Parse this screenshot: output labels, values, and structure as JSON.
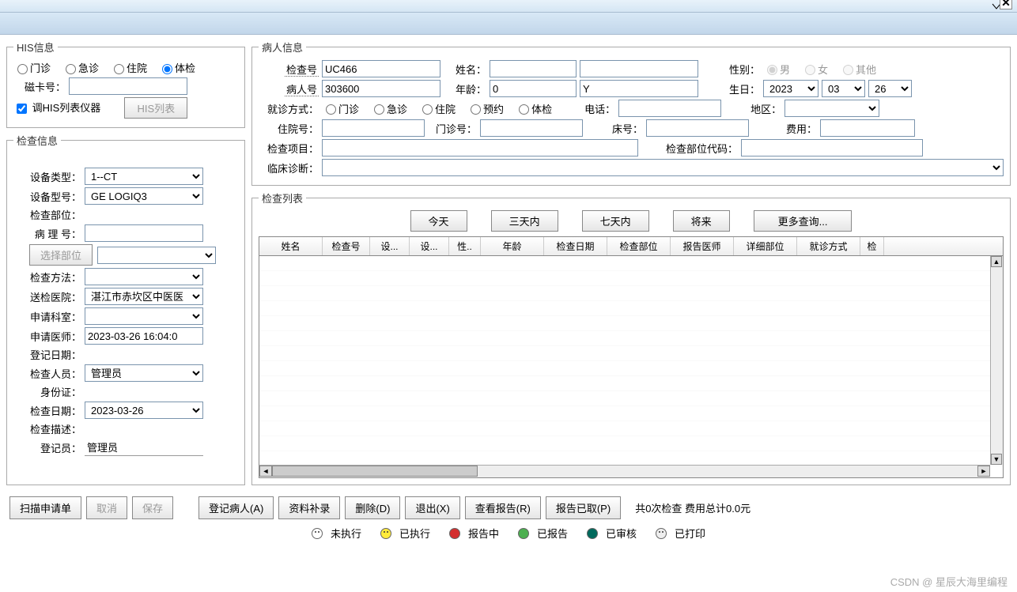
{
  "his": {
    "legend": "HIS信息",
    "radios": {
      "outpatient": "门诊",
      "emergency": "急诊",
      "inpatient": "住院",
      "checkup": "体检"
    },
    "card_label": "磁卡号：",
    "card_value": "",
    "chk_label": "调HIS列表仪器",
    "hislist_btn": "HIS列表"
  },
  "exam": {
    "legend": "检查信息",
    "device_type_label": "设备类型：",
    "device_type": "1--CT",
    "device_model_label": "设备型号：",
    "device_model": "GE LOGIQ3",
    "exam_part_label": "检查部位：",
    "exam_part": "",
    "path_no_label": "病 理 号：",
    "path_no": "",
    "select_part_btn": "选择部位",
    "select_part_val": "",
    "exam_method_label": "检查方法：",
    "exam_method": "",
    "hospital_label": "送检医院：",
    "hospital": "湛江市赤坎区中医医",
    "dept_label": "申请科室：",
    "dept": "",
    "doctor_label": "申请医师：",
    "doctor": "2023-03-26 16:04:0",
    "reg_date_label": "登记日期：",
    "examiner_label": "检查人员：",
    "examiner": "管理员",
    "id_label": "身份证：",
    "exam_date_label": "检查日期：",
    "exam_date": "2023-03-26",
    "desc_label": "检查描述：",
    "registrar_label": "登记员：",
    "registrar": "管理员"
  },
  "patient": {
    "legend": "病人信息",
    "check_no_label": "检查号",
    "check_no": "UC466",
    "patient_no_label": "病人号",
    "patient_no": "303600",
    "name_label": "姓名：",
    "name": "",
    "age_label": "年龄：",
    "age": "0",
    "age_unit": "Y",
    "sex_label": "性别：",
    "sex": {
      "male": "男",
      "female": "女",
      "other": "其他"
    },
    "birth_label": "生日：",
    "birth_year": "2023",
    "birth_month": "03",
    "birth_day": "26",
    "visit_label": "就诊方式：",
    "visit": {
      "outpatient": "门诊",
      "emergency": "急诊",
      "inpatient": "住院",
      "appointment": "预约",
      "checkup": "体检"
    },
    "phone_label": "电话：",
    "phone": "",
    "region_label": "地区：",
    "region": "",
    "adm_no_label": "住院号：",
    "adm_no": "",
    "clinic_no_label": "门诊号：",
    "clinic_no": "",
    "bed_label": "床号：",
    "bed": "",
    "fee_label": "费用：",
    "fee": "",
    "item_label": "检查项目：",
    "item": "",
    "partcode_label": "检查部位代码：",
    "partcode": "",
    "diag_label": "临床诊断：",
    "diag": ""
  },
  "list": {
    "legend": "检查列表",
    "btns": {
      "today": "今天",
      "three": "三天内",
      "seven": "七天内",
      "future": "将来",
      "more": "更多查询..."
    },
    "cols": [
      "姓名",
      "检查号",
      "设...",
      "设...",
      "性..",
      "年龄",
      "检查日期",
      "检查部位",
      "报告医师",
      "详细部位",
      "就诊方式",
      "检"
    ]
  },
  "bottom": {
    "scan": "扫描申请单",
    "cancel": "取消",
    "save": "保存",
    "reg": "登记病人(A)",
    "supplement": "资料补录",
    "delete": "删除(D)",
    "exit": "退出(X)",
    "view": "查看报告(R)",
    "got": "报告已取(P)",
    "summary": "共0次检查  费用总计0.0元"
  },
  "status": {
    "s1": "未执行",
    "s2": "已执行",
    "s3": "报告中",
    "s4": "已报告",
    "s5": "已审核",
    "s6": "已打印"
  },
  "watermark": "CSDN @ 星辰大海里编程"
}
